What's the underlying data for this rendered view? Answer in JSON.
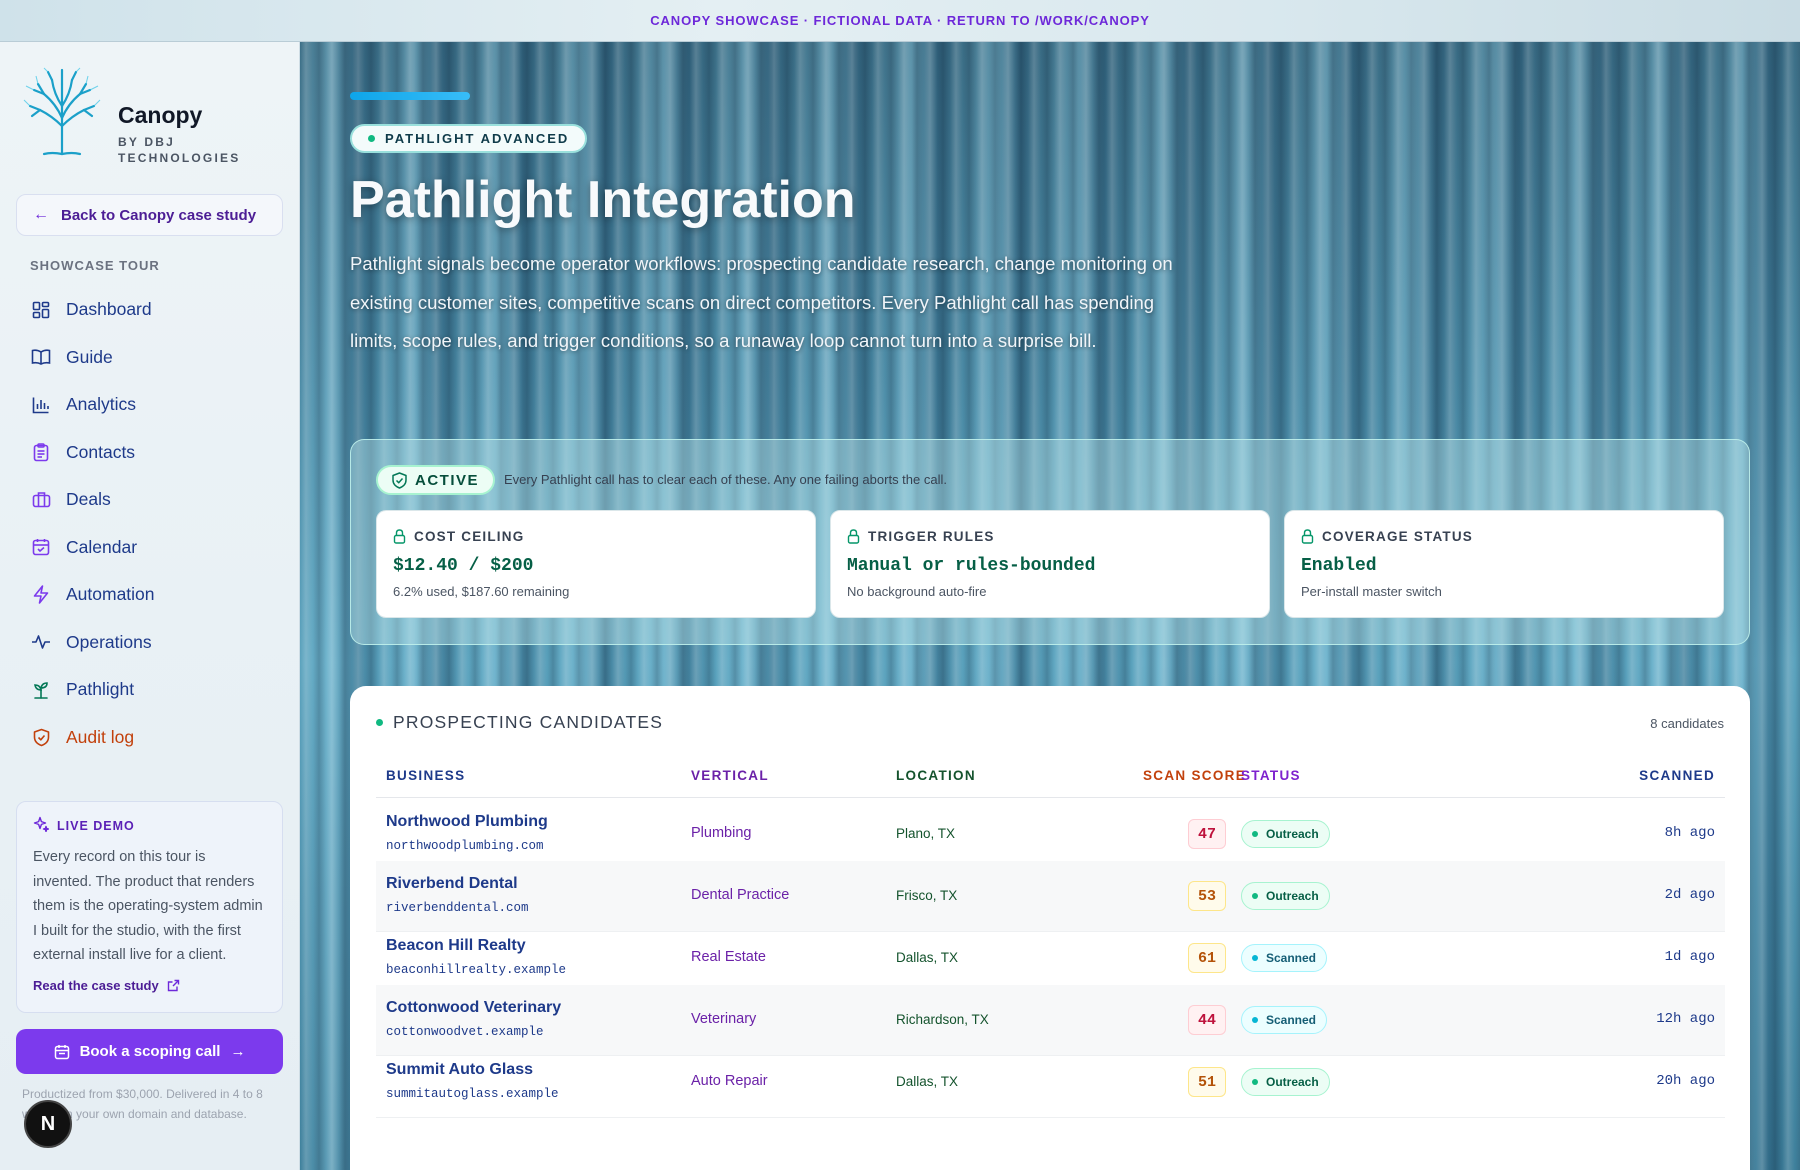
{
  "banner": {
    "text": "CANOPY SHOWCASE · FICTIONAL DATA · RETURN TO /WORK/CANOPY"
  },
  "brand": {
    "name": "Canopy",
    "sub": "BY DBJ TECHNOLOGIES"
  },
  "sidebar": {
    "back_label": "Back to Canopy case study",
    "tour_label": "SHOWCASE TOUR",
    "items": [
      {
        "label": "Dashboard",
        "icon": "dashboard-icon"
      },
      {
        "label": "Guide",
        "icon": "book-icon"
      },
      {
        "label": "Analytics",
        "icon": "bar-chart-icon"
      },
      {
        "label": "Contacts",
        "icon": "clipboard-icon"
      },
      {
        "label": "Deals",
        "icon": "briefcase-icon"
      },
      {
        "label": "Calendar",
        "icon": "calendar-icon"
      },
      {
        "label": "Automation",
        "icon": "lightning-icon"
      },
      {
        "label": "Operations",
        "icon": "pulse-icon"
      },
      {
        "label": "Pathlight",
        "icon": "sprout-icon"
      },
      {
        "label": "Audit log",
        "icon": "shield-icon"
      }
    ],
    "live_demo": {
      "title": "LIVE DEMO",
      "body": "Every record on this tour is invented. The product that renders them is the operating-system admin I built for the studio, with the first external install live for a client.",
      "link": "Read the case study"
    },
    "book_label": "Book a scoping call",
    "note": "Productized from $30,000. Delivered in 4 to 8 weeks on your own domain and database.",
    "badge": "N"
  },
  "hero": {
    "pill": "PATHLIGHT ADVANCED",
    "title": "Pathlight Integration",
    "description": "Pathlight signals become operator workflows: prospecting candidate research, change monitoring on existing customer sites, competitive scans on direct competitors. Every Pathlight call has spending limits, scope rules, and trigger conditions, so a runaway loop cannot turn into a surprise bill."
  },
  "guardrails": {
    "status": "ACTIVE",
    "note": "Every Pathlight call has to clear each of these. Any one failing aborts the call.",
    "cards": [
      {
        "title": "COST CEILING",
        "value": "$12.40 / $200",
        "sub": "6.2% used, $187.60 remaining"
      },
      {
        "title": "TRIGGER RULES",
        "value": "Manual or rules-bounded",
        "sub": "No background auto-fire"
      },
      {
        "title": "COVERAGE STATUS",
        "value": "Enabled",
        "sub": "Per-install master switch"
      }
    ]
  },
  "candidates": {
    "title": "PROSPECTING CANDIDATES",
    "count": "8 candidates",
    "columns": {
      "business": "BUSINESS",
      "vertical": "VERTICAL",
      "location": "LOCATION",
      "score": "SCAN SCORE",
      "status": "STATUS",
      "scanned": "SCANNED"
    },
    "rows": [
      {
        "name": "Northwood Plumbing",
        "url": "northwoodplumbing.com",
        "vertical": "Plumbing",
        "location": "Plano, TX",
        "score": "47",
        "score_tone": "red",
        "status": "Outreach",
        "scanned": "8h ago"
      },
      {
        "name": "Riverbend Dental",
        "url": "riverbenddental.com",
        "vertical": "Dental Practice",
        "location": "Frisco, TX",
        "score": "53",
        "score_tone": "amber",
        "status": "Outreach",
        "scanned": "2d ago"
      },
      {
        "name": "Beacon Hill Realty",
        "url": "beaconhillrealty.example",
        "vertical": "Real Estate",
        "location": "Dallas, TX",
        "score": "61",
        "score_tone": "amber",
        "status": "Scanned",
        "scanned": "1d ago"
      },
      {
        "name": "Cottonwood Veterinary",
        "url": "cottonwoodvet.example",
        "vertical": "Veterinary",
        "location": "Richardson, TX",
        "score": "44",
        "score_tone": "red",
        "status": "Scanned",
        "scanned": "12h ago"
      },
      {
        "name": "Summit Auto Glass",
        "url": "summitautoglass.example",
        "vertical": "Auto Repair",
        "location": "Dallas, TX",
        "score": "51",
        "score_tone": "amber",
        "status": "Outreach",
        "scanned": "20h ago"
      }
    ]
  }
}
